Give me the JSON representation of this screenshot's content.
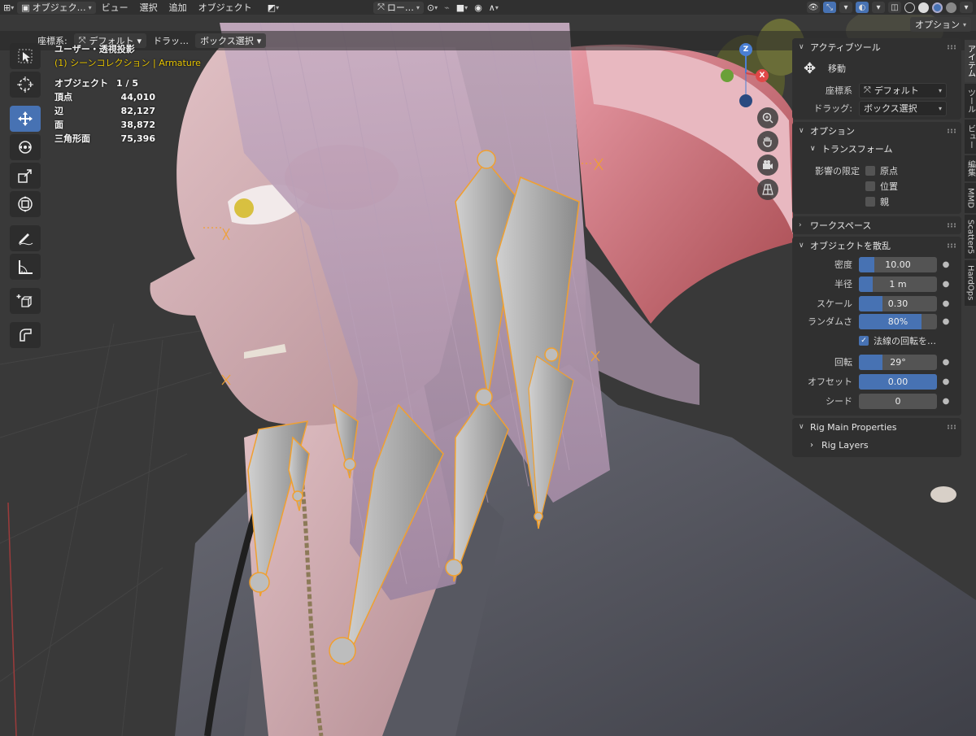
{
  "header": {
    "mode": "オブジェク…",
    "menus": [
      "ビュー",
      "選択",
      "追加",
      "オブジェクト"
    ],
    "orientation": "ロー…"
  },
  "toolbar": {
    "coord_label": "座標系:",
    "coord_value": "デフォルト",
    "drag_label": "ドラッ…",
    "drag_value": "ボックス選択",
    "options_label": "オプション"
  },
  "overlay": {
    "view_name": "ユーザー・透視投影",
    "collection": "(1) シーンコレクション | Armature",
    "stats": [
      {
        "label": "オブジェクト",
        "value": "1 / 5"
      },
      {
        "label": "頂点",
        "value": "44,010"
      },
      {
        "label": "辺",
        "value": "82,127"
      },
      {
        "label": "面",
        "value": "38,872"
      },
      {
        "label": "三角形面",
        "value": "75,396"
      }
    ]
  },
  "gizmo": {
    "x": "X",
    "y": "Y",
    "z": "Z"
  },
  "panel": {
    "active_tool": {
      "title": "アクティブツール",
      "tool_name": "移動",
      "coord_label": "座標系",
      "coord_value": "デフォルト",
      "drag_label": "ドラッグ:",
      "drag_value": "ボックス選択"
    },
    "options": {
      "title": "オプション",
      "transform_title": "トランスフォーム",
      "affect_label": "影響の限定",
      "affect_items": [
        {
          "label": "原点",
          "checked": false
        },
        {
          "label": "位置",
          "checked": false
        },
        {
          "label": "親",
          "checked": false
        }
      ]
    },
    "workspace": {
      "title": "ワークスペース"
    },
    "scatter": {
      "title": "オブジェクトを散乱",
      "fields": [
        {
          "label": "密度",
          "value": "10.00",
          "fill": 0.2
        },
        {
          "label": "半径",
          "value": "1 m",
          "fill": 0.18
        },
        {
          "label": "スケール",
          "value": "0.30",
          "fill": 0.3
        },
        {
          "label": "ランダムさ",
          "value": "80%",
          "fill": 0.8
        }
      ],
      "normal_rotation": {
        "label": "法線の回転を…",
        "checked": true
      },
      "fields2": [
        {
          "label": "回転",
          "value": "29°",
          "fill": 0.3
        },
        {
          "label": "オフセット",
          "value": "0.00",
          "fill": 1.0
        },
        {
          "label": "シード",
          "value": "0",
          "fill": 0.0
        }
      ]
    },
    "rig": {
      "title": "Rig Main Properties",
      "layers": "Rig Layers"
    }
  },
  "vtabs": [
    "アイテム",
    "ツール",
    "ビュー",
    "編集",
    "MMD",
    "Scatter5",
    "HardOps"
  ],
  "colors": {
    "accent": "#4772b3",
    "panel_bg": "#303030",
    "bone_outline": "#f0a030",
    "collection_text": "#e6c300"
  }
}
